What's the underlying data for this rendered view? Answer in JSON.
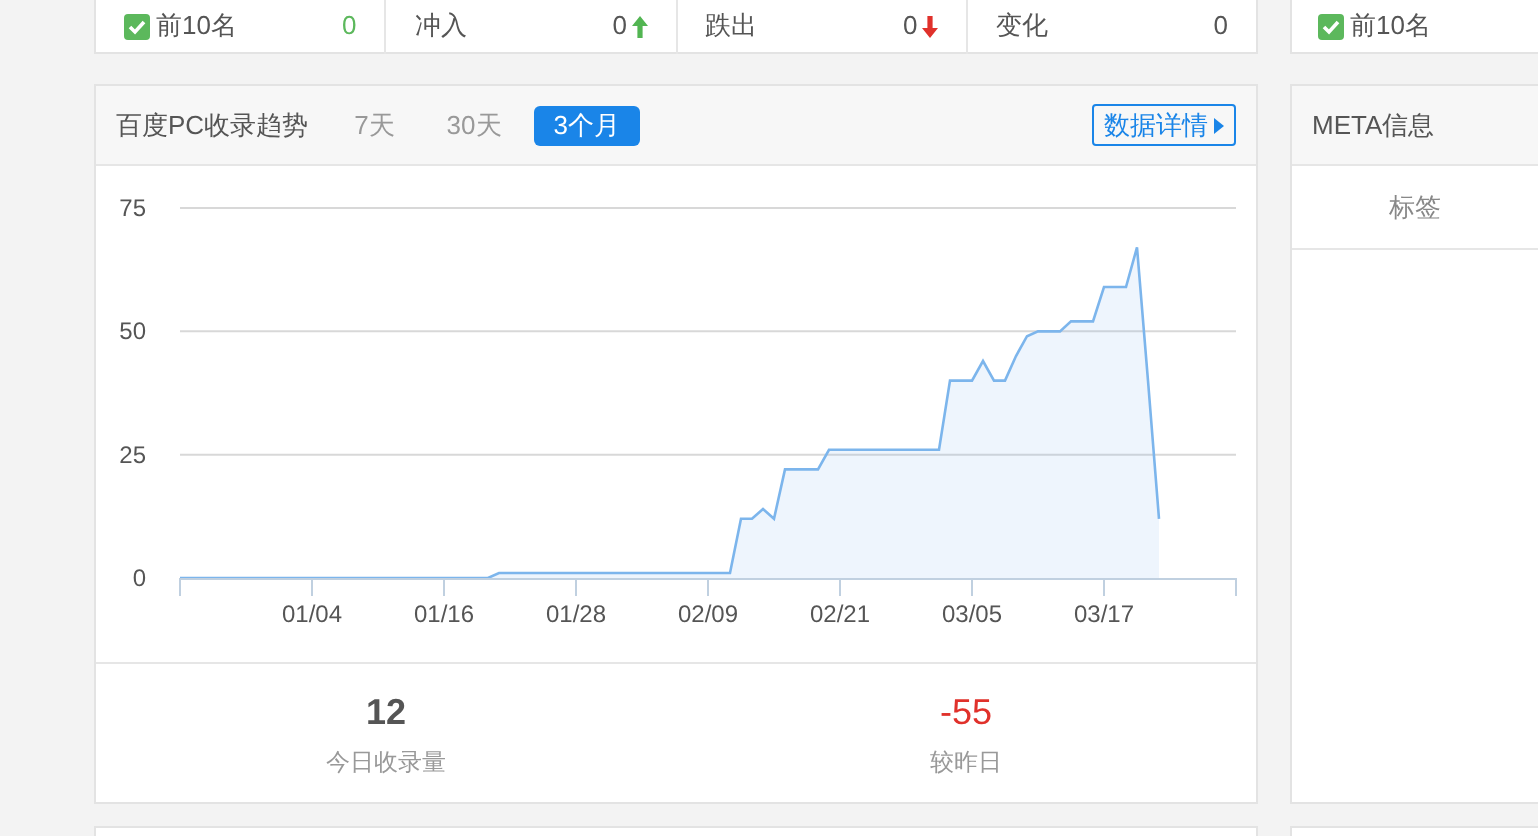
{
  "top_stats": {
    "items": [
      {
        "kind": "check",
        "label": "前10名",
        "value": "0",
        "checked": true
      },
      {
        "kind": "rise",
        "label": "冲入",
        "value": "0"
      },
      {
        "kind": "fall",
        "label": "跌出",
        "value": "0"
      },
      {
        "kind": "plain",
        "label": "变化",
        "value": "0"
      }
    ]
  },
  "top_side": {
    "label": "前10名",
    "checked": true
  },
  "trend_panel": {
    "title": "百度PC收录趋势",
    "tabs": [
      {
        "label": "7天",
        "selected": false
      },
      {
        "label": "30天",
        "selected": false
      },
      {
        "label": "3个月",
        "selected": true
      }
    ],
    "details_button": "数据详情",
    "chart_data": {
      "type": "area",
      "categories": [
        null,
        null,
        null,
        null,
        null,
        null,
        null,
        null,
        null,
        null,
        null,
        null,
        "01/04",
        null,
        null,
        null,
        null,
        null,
        null,
        null,
        null,
        null,
        null,
        null,
        "01/16",
        null,
        null,
        null,
        null,
        null,
        null,
        null,
        null,
        null,
        null,
        null,
        "01/28",
        null,
        null,
        null,
        null,
        null,
        null,
        null,
        null,
        null,
        null,
        null,
        "02/09",
        null,
        null,
        null,
        null,
        null,
        null,
        null,
        null,
        null,
        null,
        null,
        "02/21",
        null,
        null,
        null,
        null,
        null,
        null,
        null,
        null,
        null,
        null,
        null,
        "03/05",
        null,
        null,
        null,
        null,
        null,
        null,
        null,
        null,
        null,
        null,
        null,
        "03/17",
        null,
        null,
        null,
        null,
        null,
        null,
        null,
        null,
        null,
        null,
        null,
        null
      ],
      "series": [
        {
          "color": "#7cb5ec",
          "values": [
            0,
            0,
            0,
            0,
            0,
            0,
            0,
            0,
            0,
            0,
            0,
            0,
            0,
            0,
            0,
            0,
            0,
            0,
            0,
            0,
            0,
            0,
            0,
            0,
            0,
            0,
            0,
            0,
            0,
            1,
            1,
            1,
            1,
            1,
            1,
            1,
            1,
            1,
            1,
            1,
            1,
            1,
            1,
            1,
            1,
            1,
            1,
            1,
            1,
            1,
            1,
            12,
            12,
            14,
            12,
            22,
            22,
            22,
            22,
            26,
            26,
            26,
            26,
            26,
            26,
            26,
            26,
            26,
            26,
            26,
            40,
            40,
            40,
            44,
            40,
            40,
            45,
            49,
            50,
            50,
            50,
            52,
            52,
            52,
            59,
            59,
            59,
            67,
            40,
            12,
            null,
            null,
            null,
            null,
            null,
            null,
            null
          ]
        }
      ],
      "ylim": [
        0,
        75
      ],
      "yticks": [
        0,
        25,
        50,
        75
      ]
    },
    "stats": [
      {
        "kind": "count",
        "value": "12",
        "label": "今日收录量"
      },
      {
        "kind": "change",
        "value": "-55",
        "label": "较昨日"
      }
    ]
  },
  "meta_panel": {
    "title": "META信息",
    "row_label": "标签"
  }
}
